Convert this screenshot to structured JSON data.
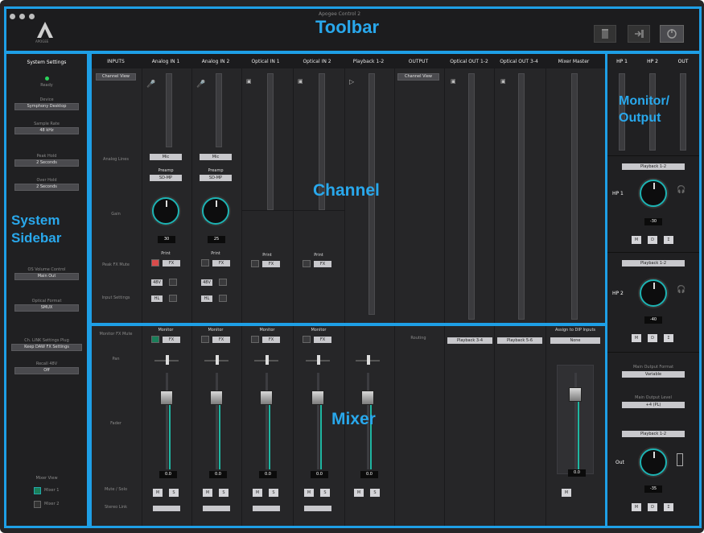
{
  "window": {
    "title": "Apogee Control 2",
    "logo_text": "APOGEE"
  },
  "regions": {
    "toolbar": "Toolbar",
    "sidebar": "System Sidebar",
    "channel": "Channel",
    "mixer": "Mixer",
    "monitor": "Monitor/ Output"
  },
  "sidebar": {
    "header": "System Settings",
    "status": "Ready",
    "device_label": "Device",
    "device_value": "Symphony Desktop",
    "sample_rate_label": "Sample Rate",
    "sample_rate_value": "48 kHz",
    "peak_hold_label": "Peak Hold",
    "peak_hold_value": "2 Seconds",
    "over_hold_label": "Over Hold",
    "over_hold_value": "2 Seconds",
    "volume_ctrl_label": "OS Volume Control",
    "volume_ctrl_value": "Main Out",
    "optical_label": "Optical Format",
    "optical_value": "SMUX",
    "fx_label": "Ch. LINK Settings Plug",
    "fx_value": "Keep DAW FX Settings",
    "recall_label": "Recall 48V",
    "recall_value": "Off",
    "mixer_view_label": "Mixer View",
    "mixer1": "Mixer 1",
    "mixer2": "Mixer 2"
  },
  "channel": {
    "headers": [
      "INPUTS",
      "Analog IN 1",
      "Analog IN 2",
      "Optical IN 1",
      "Optical IN 2",
      "Playback 1-2",
      "OUTPUT",
      "Optical OUT 1-2",
      "Optical OUT 3-4",
      "Mixer Master"
    ],
    "channel_view": "Channel View",
    "row_labels": {
      "analog": "Analog Lines",
      "gain": "Gain",
      "fx": "Peak FX Mute",
      "input": "Input Settings"
    },
    "mic_label": "Mic",
    "preamp_label": "Preamp",
    "preamp_value": "SD-MP",
    "gain_in1": "30",
    "gain_in2": "25",
    "print_label": "Print",
    "fx_label": "FX",
    "phantom": "48V",
    "hpf": "HL"
  },
  "mixer": {
    "row_labels": {
      "monitor": "Monitor FX Mute",
      "pan": "Pan",
      "fader": "Fader",
      "mute_solo": "Mute / Solo",
      "stereo": "Stereo Link"
    },
    "monitor_label": "Monitor",
    "routing_label": "Routing",
    "out12": "Playback 3-4",
    "out34": "Playback 5-6",
    "assign_label": "Assign to DIP Inputs",
    "assign_value": "None",
    "fader_value": "0.0",
    "mute": "M",
    "solo": "S"
  },
  "monitor": {
    "headers": [
      "HP 1",
      "HP 2",
      "OUT"
    ],
    "hp1_source": "Playback 1-2",
    "hp1_label": "HP 1",
    "hp1_value": "-30",
    "hp2_source": "Playback 1-2",
    "hp2_label": "HP 2",
    "hp2_value": "-40",
    "format_label": "Main Output Format",
    "format_value": "Variable",
    "level_label": "Main Output Level",
    "level_value": "+4 (PL)",
    "out_source": "Playback 1-2",
    "out_label": "Out",
    "out_value": "-35",
    "mute": "M",
    "dim": "D",
    "sum": "Σ"
  }
}
